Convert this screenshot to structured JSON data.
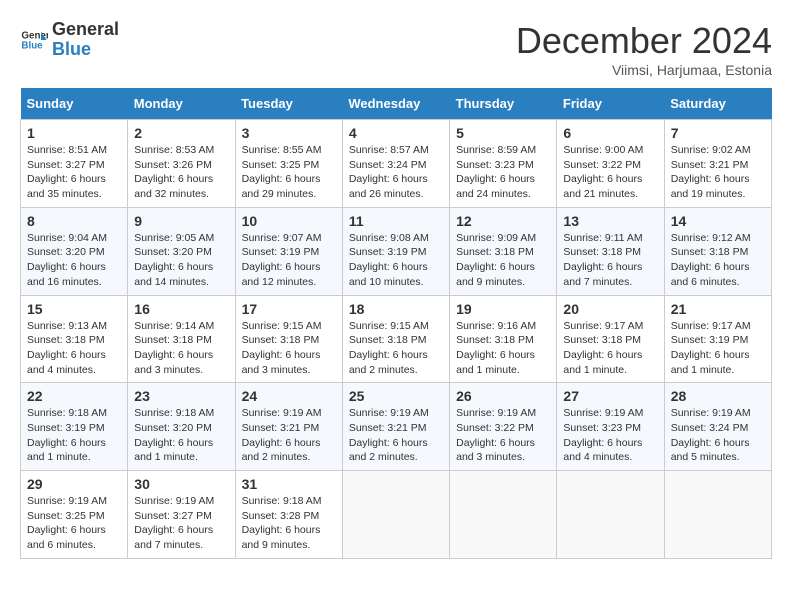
{
  "header": {
    "logo_line1": "General",
    "logo_line2": "Blue",
    "month_title": "December 2024",
    "subtitle": "Viimsi, Harjumaa, Estonia"
  },
  "days_of_week": [
    "Sunday",
    "Monday",
    "Tuesday",
    "Wednesday",
    "Thursday",
    "Friday",
    "Saturday"
  ],
  "weeks": [
    [
      {
        "day": "1",
        "sunrise": "8:51 AM",
        "sunset": "3:27 PM",
        "daylight": "6 hours and 35 minutes."
      },
      {
        "day": "2",
        "sunrise": "8:53 AM",
        "sunset": "3:26 PM",
        "daylight": "6 hours and 32 minutes."
      },
      {
        "day": "3",
        "sunrise": "8:55 AM",
        "sunset": "3:25 PM",
        "daylight": "6 hours and 29 minutes."
      },
      {
        "day": "4",
        "sunrise": "8:57 AM",
        "sunset": "3:24 PM",
        "daylight": "6 hours and 26 minutes."
      },
      {
        "day": "5",
        "sunrise": "8:59 AM",
        "sunset": "3:23 PM",
        "daylight": "6 hours and 24 minutes."
      },
      {
        "day": "6",
        "sunrise": "9:00 AM",
        "sunset": "3:22 PM",
        "daylight": "6 hours and 21 minutes."
      },
      {
        "day": "7",
        "sunrise": "9:02 AM",
        "sunset": "3:21 PM",
        "daylight": "6 hours and 19 minutes."
      }
    ],
    [
      {
        "day": "8",
        "sunrise": "9:04 AM",
        "sunset": "3:20 PM",
        "daylight": "6 hours and 16 minutes."
      },
      {
        "day": "9",
        "sunrise": "9:05 AM",
        "sunset": "3:20 PM",
        "daylight": "6 hours and 14 minutes."
      },
      {
        "day": "10",
        "sunrise": "9:07 AM",
        "sunset": "3:19 PM",
        "daylight": "6 hours and 12 minutes."
      },
      {
        "day": "11",
        "sunrise": "9:08 AM",
        "sunset": "3:19 PM",
        "daylight": "6 hours and 10 minutes."
      },
      {
        "day": "12",
        "sunrise": "9:09 AM",
        "sunset": "3:18 PM",
        "daylight": "6 hours and 9 minutes."
      },
      {
        "day": "13",
        "sunrise": "9:11 AM",
        "sunset": "3:18 PM",
        "daylight": "6 hours and 7 minutes."
      },
      {
        "day": "14",
        "sunrise": "9:12 AM",
        "sunset": "3:18 PM",
        "daylight": "6 hours and 6 minutes."
      }
    ],
    [
      {
        "day": "15",
        "sunrise": "9:13 AM",
        "sunset": "3:18 PM",
        "daylight": "6 hours and 4 minutes."
      },
      {
        "day": "16",
        "sunrise": "9:14 AM",
        "sunset": "3:18 PM",
        "daylight": "6 hours and 3 minutes."
      },
      {
        "day": "17",
        "sunrise": "9:15 AM",
        "sunset": "3:18 PM",
        "daylight": "6 hours and 3 minutes."
      },
      {
        "day": "18",
        "sunrise": "9:15 AM",
        "sunset": "3:18 PM",
        "daylight": "6 hours and 2 minutes."
      },
      {
        "day": "19",
        "sunrise": "9:16 AM",
        "sunset": "3:18 PM",
        "daylight": "6 hours and 1 minute."
      },
      {
        "day": "20",
        "sunrise": "9:17 AM",
        "sunset": "3:18 PM",
        "daylight": "6 hours and 1 minute."
      },
      {
        "day": "21",
        "sunrise": "9:17 AM",
        "sunset": "3:19 PM",
        "daylight": "6 hours and 1 minute."
      }
    ],
    [
      {
        "day": "22",
        "sunrise": "9:18 AM",
        "sunset": "3:19 PM",
        "daylight": "6 hours and 1 minute."
      },
      {
        "day": "23",
        "sunrise": "9:18 AM",
        "sunset": "3:20 PM",
        "daylight": "6 hours and 1 minute."
      },
      {
        "day": "24",
        "sunrise": "9:19 AM",
        "sunset": "3:21 PM",
        "daylight": "6 hours and 2 minutes."
      },
      {
        "day": "25",
        "sunrise": "9:19 AM",
        "sunset": "3:21 PM",
        "daylight": "6 hours and 2 minutes."
      },
      {
        "day": "26",
        "sunrise": "9:19 AM",
        "sunset": "3:22 PM",
        "daylight": "6 hours and 3 minutes."
      },
      {
        "day": "27",
        "sunrise": "9:19 AM",
        "sunset": "3:23 PM",
        "daylight": "6 hours and 4 minutes."
      },
      {
        "day": "28",
        "sunrise": "9:19 AM",
        "sunset": "3:24 PM",
        "daylight": "6 hours and 5 minutes."
      }
    ],
    [
      {
        "day": "29",
        "sunrise": "9:19 AM",
        "sunset": "3:25 PM",
        "daylight": "6 hours and 6 minutes."
      },
      {
        "day": "30",
        "sunrise": "9:19 AM",
        "sunset": "3:27 PM",
        "daylight": "6 hours and 7 minutes."
      },
      {
        "day": "31",
        "sunrise": "9:18 AM",
        "sunset": "3:28 PM",
        "daylight": "6 hours and 9 minutes."
      },
      null,
      null,
      null,
      null
    ]
  ]
}
